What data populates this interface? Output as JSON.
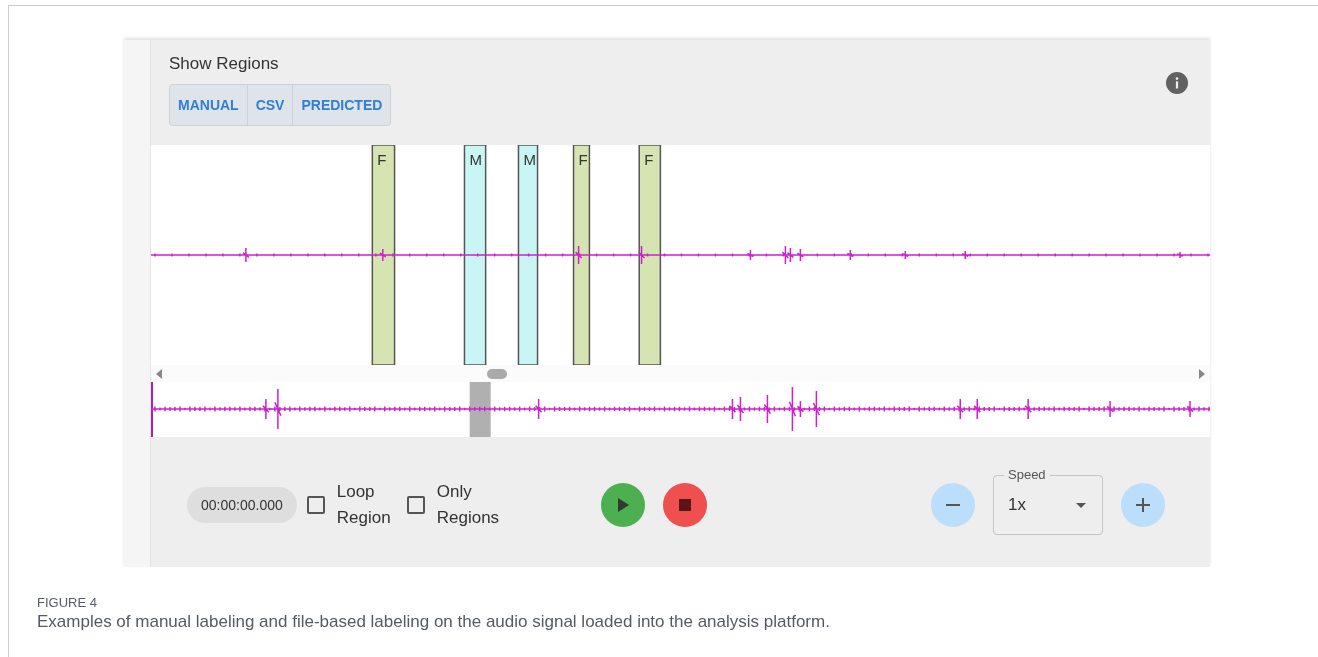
{
  "header": {
    "title": "Show Regions",
    "toggles": [
      {
        "label": "MANUAL"
      },
      {
        "label": "CSV"
      },
      {
        "label": "PREDICTED"
      }
    ]
  },
  "regions": [
    {
      "label": "F",
      "color": "#d6e4b2"
    },
    {
      "label": "M",
      "color": "#c9f5f5"
    },
    {
      "label": "M",
      "color": "#c9f5f5"
    },
    {
      "label": "F",
      "color": "#d6e4b2"
    },
    {
      "label": "F",
      "color": "#d6e4b2"
    }
  ],
  "controls": {
    "time": "00:00:00.000",
    "checkboxes": [
      {
        "label": "Loop Region",
        "checked": false
      },
      {
        "label": "Only Regions",
        "checked": false
      }
    ],
    "speed": {
      "label": "Speed",
      "value": "1x"
    }
  },
  "caption": {
    "figure": "FIGURE 4",
    "text": "Examples of manual labeling and file-based labeling on the audio signal loaded into the analysis platform."
  }
}
